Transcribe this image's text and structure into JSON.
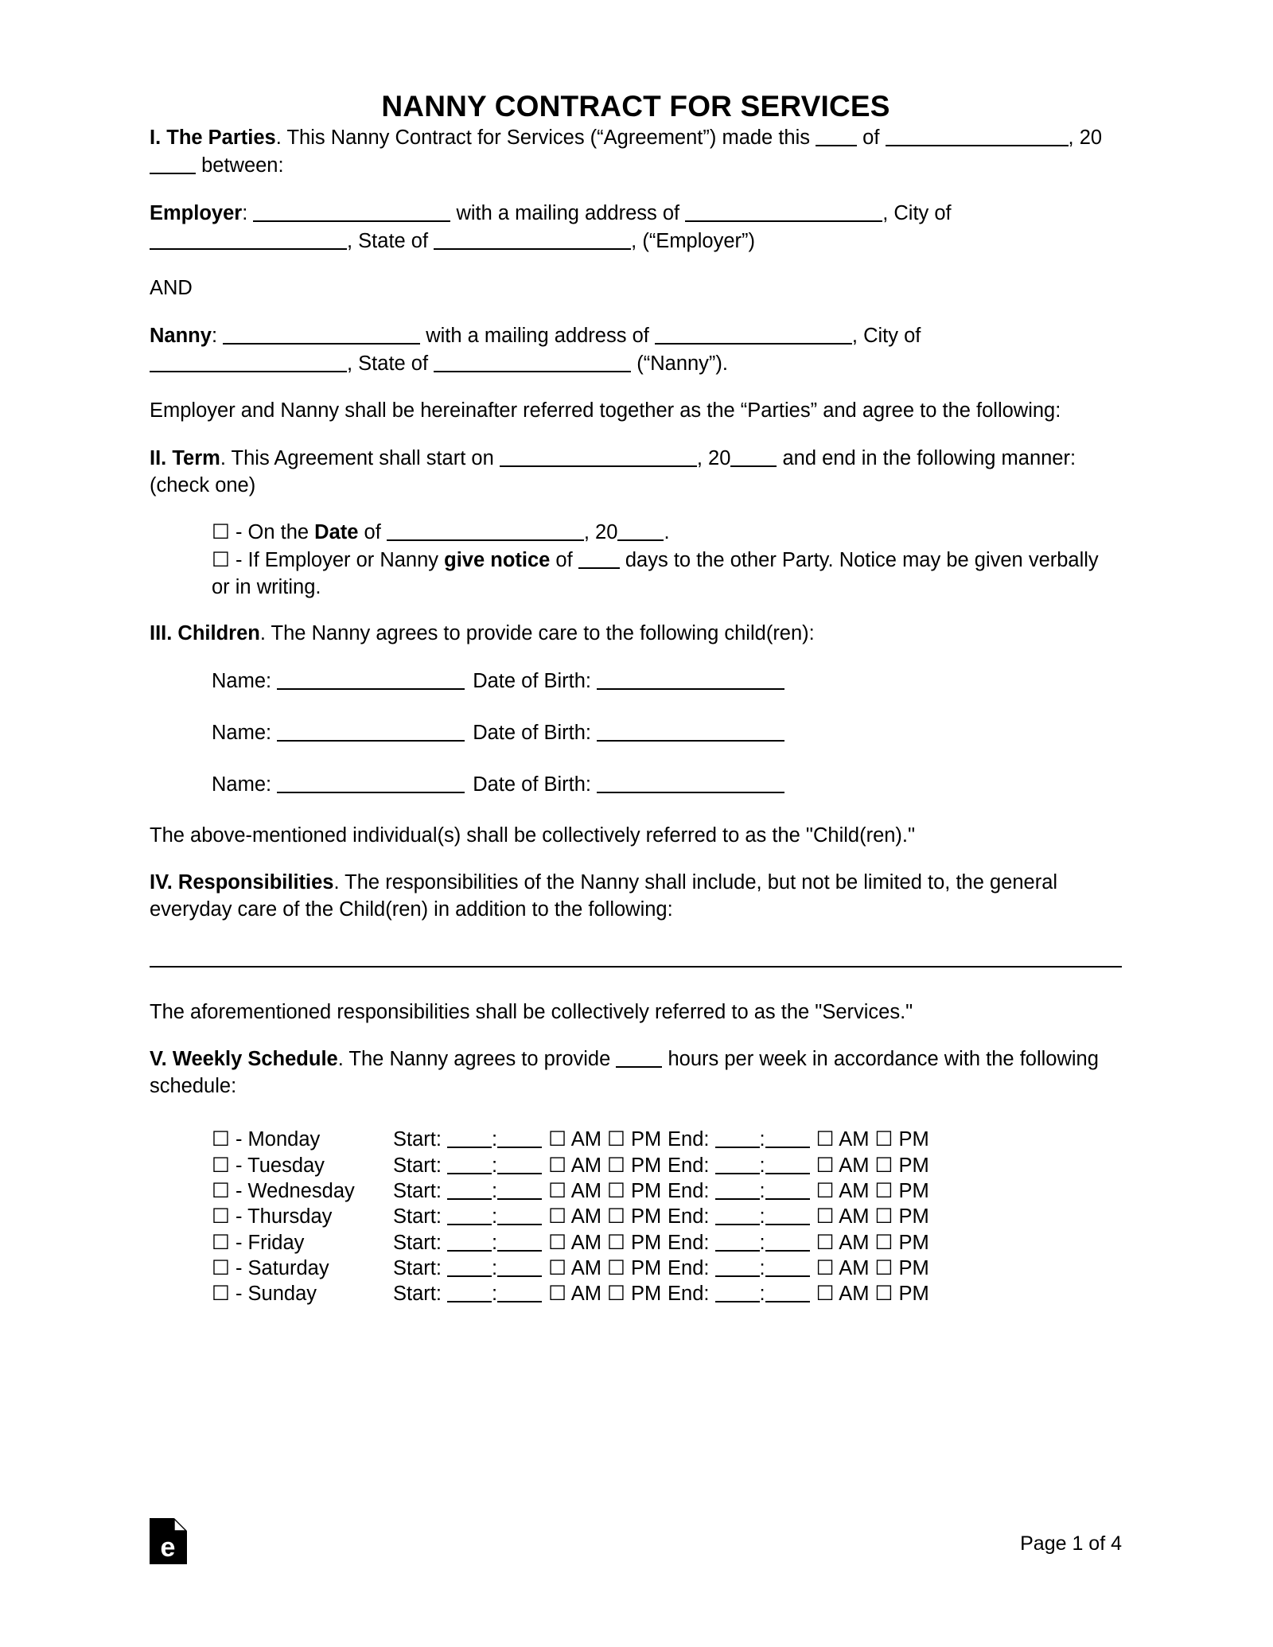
{
  "document": {
    "title": "NANNY CONTRACT FOR SERVICES",
    "page_footer": "Page 1 of 4",
    "logo_name": "eforms-logo",
    "logo_letter": "e"
  },
  "sections": {
    "parties": {
      "heading": "I. The Parties",
      "line1_a": ". This Nanny Contract for Services (“Agreement”) made this ",
      "line1_b": " of ",
      "line1_c": ", 20",
      "line1_d": " between:",
      "employer_label": "Employer",
      "employer_a": ": ",
      "employer_b": " with a mailing address of ",
      "employer_c": ", City of ",
      "employer_d": ", State of ",
      "employer_e": ", (“Employer”)",
      "and_text": "AND",
      "nanny_label": "Nanny",
      "nanny_a": ": ",
      "nanny_b": " with a mailing address of ",
      "nanny_c": ", City of ",
      "nanny_d": ", State of ",
      "nanny_e": " (“Nanny”).",
      "closing": "Employer and Nanny shall be hereinafter referred together as the “Parties” and agree to the following:"
    },
    "term": {
      "heading": "II. Term",
      "body_a": ". This Agreement shall start on ",
      "body_b": ", 20",
      "body_c": " and end in the following manner: (check one)",
      "option1_a": " - On the ",
      "option1_bold": "Date",
      "option1_b": " of ",
      "option1_c": ", 20",
      "option1_d": ".",
      "option2_a": " - If Employer or Nanny ",
      "option2_bold": "give notice",
      "option2_b": " of ",
      "option2_c": " days to the other Party. Notice may be given verbally or in writing."
    },
    "children": {
      "heading": "III. Children",
      "body": ". The Nanny agrees to provide care to the following child(ren):",
      "name_label": "Name: ",
      "dob_label": "Date of Birth: ",
      "rows": [
        1,
        2,
        3
      ],
      "closing": "The above-mentioned individual(s) shall be collectively referred to as the \"Child(ren).\""
    },
    "responsibilities": {
      "heading": "IV. Responsibilities",
      "body": ". The responsibilities of the Nanny shall include, but not be limited to, the general everyday care of the Child(ren) in addition to the following:",
      "closing": "The aforementioned responsibilities shall be collectively referred to as the \"Services.\""
    },
    "schedule": {
      "heading": "V. Weekly Schedule",
      "body_a": ". The Nanny agrees to provide ",
      "body_b": " hours per week in accordance with the following schedule:",
      "start_label": "Start: ",
      "end_label": "End: ",
      "colon": ":",
      "am_label": "AM",
      "pm_label": "PM",
      "checkbox_glyph": "☐",
      "dash": " - ",
      "days": [
        "Monday",
        "Tuesday",
        "Wednesday",
        "Thursday",
        "Friday",
        "Saturday",
        "Sunday"
      ]
    }
  }
}
